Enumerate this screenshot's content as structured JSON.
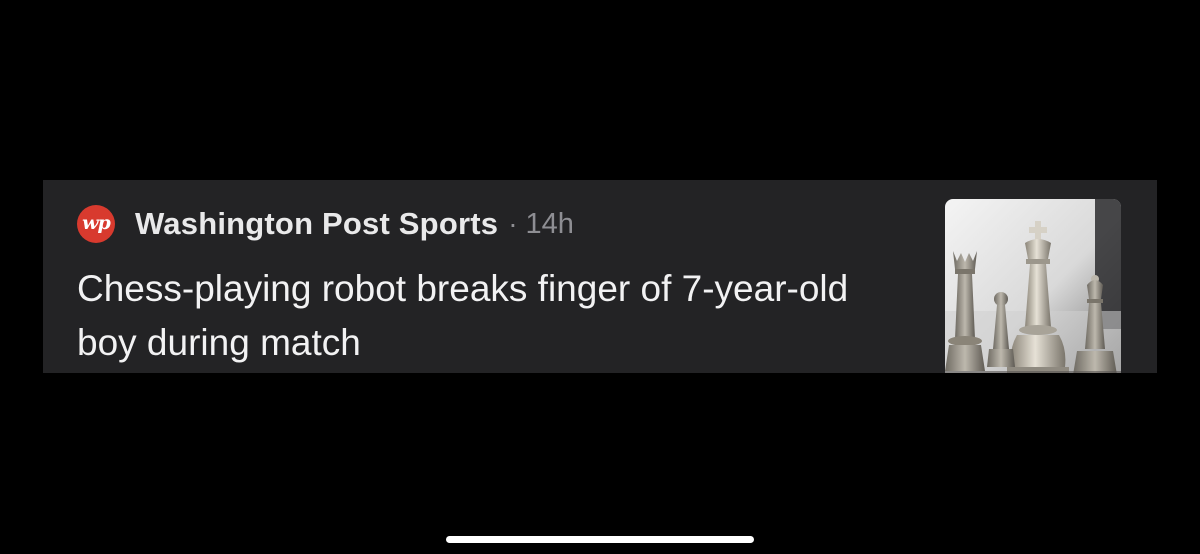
{
  "colors": {
    "screen_background": "#000000",
    "card_background": "#232325",
    "logo_red": "#d83a2e",
    "source_text": "#e9e9ea",
    "meta_text": "#8e8e93",
    "headline_text": "#f2f2f3",
    "home_indicator": "#ffffff"
  },
  "news_card": {
    "source": {
      "logo_icon": "washington-post-logo-icon",
      "logo_text": "wp",
      "name": "Washington Post Sports",
      "separator": "·",
      "time": "14h"
    },
    "headline": "Chess-playing robot breaks finger of 7-year-old boy during match",
    "thumbnail_icon": "chess-pieces-photo"
  }
}
